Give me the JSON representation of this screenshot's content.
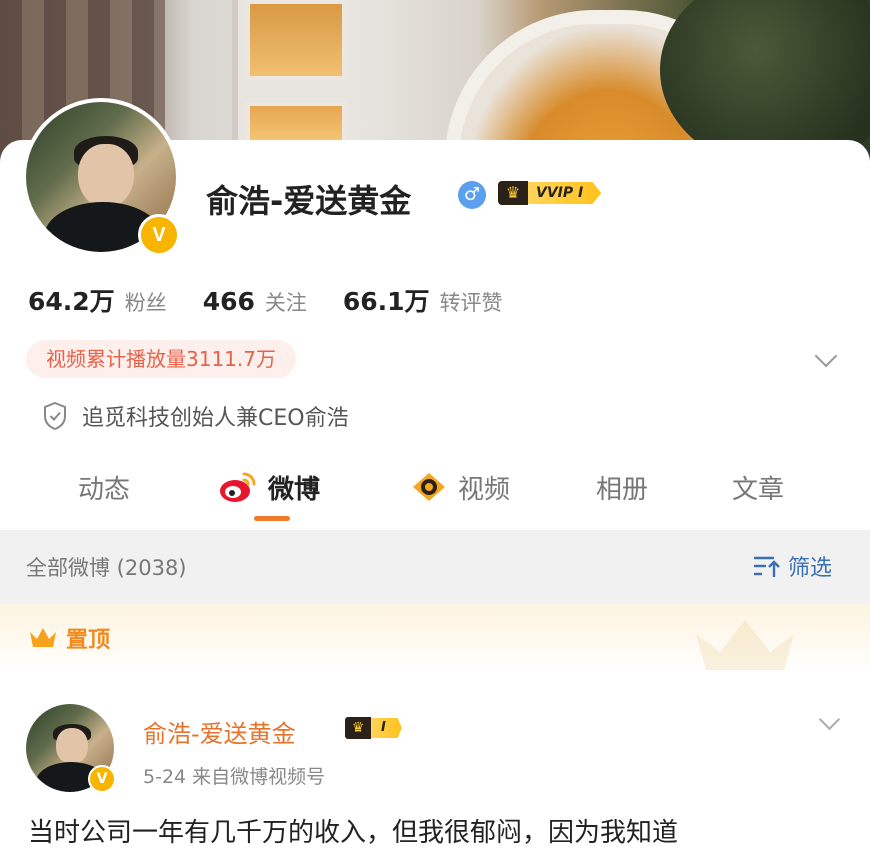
{
  "profile": {
    "name": "俞浩-爱送黄金",
    "vip_label": "VVIP I",
    "verified_badge": "V",
    "gender_symbol": "♂"
  },
  "stats": [
    {
      "value": "64.2万",
      "label": "粉丝"
    },
    {
      "value": "466",
      "label": "关注"
    },
    {
      "value": "66.1万",
      "label": "转评赞"
    }
  ],
  "video_views": "视频累计播放量3111.7万",
  "certification": "追觅科技创始人兼CEO俞浩",
  "tabs": [
    {
      "label": "动态",
      "active": false
    },
    {
      "label": "微博",
      "active": true,
      "icon": "weibo-icon"
    },
    {
      "label": "视频",
      "active": false,
      "icon": "video-icon"
    },
    {
      "label": "相册",
      "active": false
    },
    {
      "label": "文章",
      "active": false
    }
  ],
  "filter": {
    "count_label": "全部微博 (2038)",
    "button_label": "筛选"
  },
  "pinned": {
    "label": "置顶"
  },
  "post": {
    "author": "俞浩-爱送黄金",
    "vip_label": "I",
    "meta": "5-24  来自微博视频号",
    "text": "当时公司一年有几千万的收入，但我很郁闷，因为我知道"
  },
  "colors": {
    "accent_orange": "#f47b2a",
    "badge_gold": "#f7b500",
    "link_blue": "#3a6fb4",
    "pill_text": "#e8624a"
  }
}
